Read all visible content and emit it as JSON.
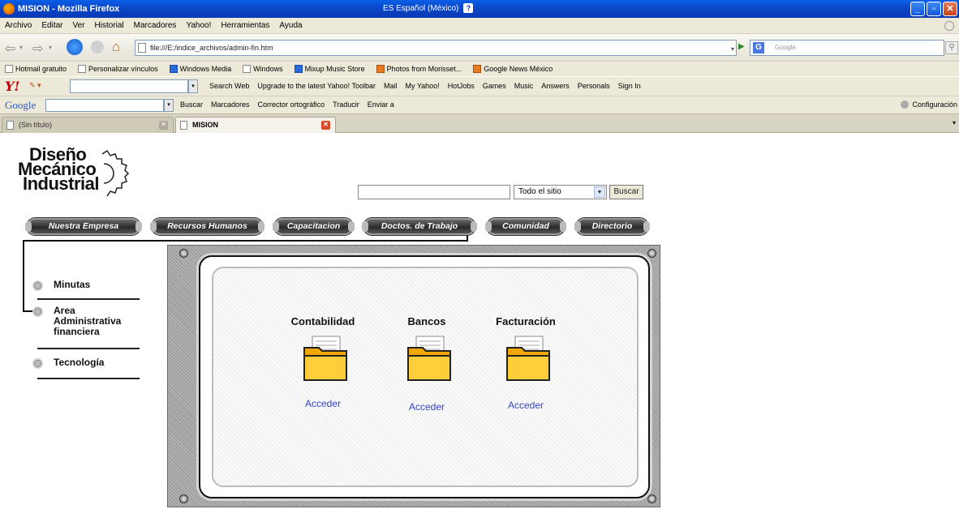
{
  "window": {
    "title": "MISION - Mozilla Firefox",
    "language": "ES Español (México)"
  },
  "menu": [
    "Archivo",
    "Editar",
    "Ver",
    "Historial",
    "Marcadores",
    "Yahoo!",
    "Herramientas",
    "Ayuda"
  ],
  "url": "file:///E:/indice_archivos/admin-fin.htm",
  "google_search_placeholder": "Google",
  "bookmarks": [
    "Hotmail gratuito",
    "Personalizar vínculos",
    "Windows Media",
    "Windows",
    "Mixup Music Store",
    "Photos from Morisset...",
    "Google News México"
  ],
  "yahoo_toolbar": {
    "logo": "Y!",
    "items": [
      "Search Web",
      "Upgrade to the latest Yahoo! Toolbar",
      "Mail",
      "My Yahoo!",
      "HotJobs",
      "Games",
      "Music",
      "Answers",
      "Personals",
      "Sign In"
    ]
  },
  "google_toolbar": {
    "logo": "Google",
    "items": [
      "Buscar",
      "Marcadores",
      "Corrector ortográfico",
      "Traducir",
      "Enviar a"
    ],
    "config": "Configuración"
  },
  "tabs": [
    {
      "label": "(Sin título)"
    },
    {
      "label": "MISION"
    }
  ],
  "logo": {
    "line1": "Diseño",
    "line2": "Mecánico",
    "line3": "Industrial"
  },
  "site_search": {
    "value": "",
    "scope": "Todo el sitio",
    "button": "Buscar"
  },
  "nav": [
    "Nuestra Empresa",
    "Recursos Humanos",
    "Capacitacion",
    "Doctos. de Trabajo",
    "Comunidad",
    "Directorio"
  ],
  "sidebar": [
    {
      "label": "Minutas"
    },
    {
      "label": "Area Administrativa financiera"
    },
    {
      "label": "Tecnología"
    }
  ],
  "folders": [
    {
      "title": "Contabilidad",
      "link": "Acceder"
    },
    {
      "title": "Bancos",
      "link": "Acceder"
    },
    {
      "title": "Facturación",
      "link": "Acceder"
    }
  ]
}
